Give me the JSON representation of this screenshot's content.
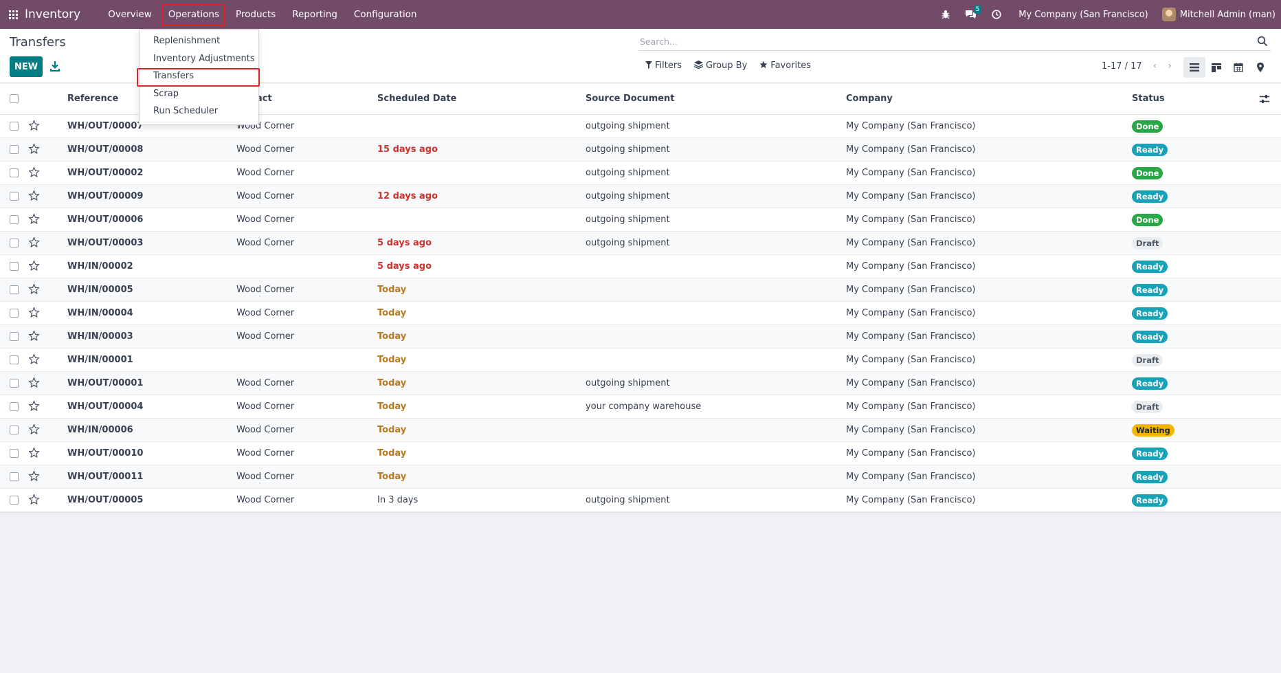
{
  "navbar": {
    "brand": "Inventory",
    "menu": [
      "Overview",
      "Operations",
      "Products",
      "Reporting",
      "Configuration"
    ],
    "messages_count": "5",
    "company": "My Company (San Francisco)",
    "user": "Mitchell Admin (man)"
  },
  "control": {
    "title": "Transfers",
    "new_label": "NEW",
    "search_placeholder": "Search...",
    "filters": "Filters",
    "group_by": "Group By",
    "favorites": "Favorites",
    "pager": "1-17 / 17"
  },
  "dropdown": {
    "items": [
      "Replenishment",
      "Inventory Adjustments",
      "Transfers",
      "Scrap",
      "Run Scheduler"
    ],
    "highlighted": "Transfers"
  },
  "table": {
    "columns": {
      "reference": "Reference",
      "contact": "act",
      "scheduled": "Scheduled Date",
      "source": "Source Document",
      "company": "Company",
      "status": "Status"
    },
    "rows": [
      {
        "ref": "WH/OUT/00007",
        "contact": "Wood Corner",
        "date": "",
        "date_style": "normal",
        "source": "outgoing shipment",
        "company": "My Company (San Francisco)",
        "status": "Done"
      },
      {
        "ref": "WH/OUT/00008",
        "contact": "Wood Corner",
        "date": "15 days ago",
        "date_style": "red",
        "source": "outgoing shipment",
        "company": "My Company (San Francisco)",
        "status": "Ready"
      },
      {
        "ref": "WH/OUT/00002",
        "contact": "Wood Corner",
        "date": "",
        "date_style": "normal",
        "source": "outgoing shipment",
        "company": "My Company (San Francisco)",
        "status": "Done"
      },
      {
        "ref": "WH/OUT/00009",
        "contact": "Wood Corner",
        "date": "12 days ago",
        "date_style": "red",
        "source": "outgoing shipment",
        "company": "My Company (San Francisco)",
        "status": "Ready"
      },
      {
        "ref": "WH/OUT/00006",
        "contact": "Wood Corner",
        "date": "",
        "date_style": "normal",
        "source": "outgoing shipment",
        "company": "My Company (San Francisco)",
        "status": "Done"
      },
      {
        "ref": "WH/OUT/00003",
        "contact": "Wood Corner",
        "date": "5 days ago",
        "date_style": "red",
        "source": "outgoing shipment",
        "company": "My Company (San Francisco)",
        "status": "Draft"
      },
      {
        "ref": "WH/IN/00002",
        "contact": "",
        "date": "5 days ago",
        "date_style": "red",
        "source": "",
        "company": "My Company (San Francisco)",
        "status": "Ready"
      },
      {
        "ref": "WH/IN/00005",
        "contact": "Wood Corner",
        "date": "Today",
        "date_style": "amber",
        "source": "",
        "company": "My Company (San Francisco)",
        "status": "Ready"
      },
      {
        "ref": "WH/IN/00004",
        "contact": "Wood Corner",
        "date": "Today",
        "date_style": "amber",
        "source": "",
        "company": "My Company (San Francisco)",
        "status": "Ready"
      },
      {
        "ref": "WH/IN/00003",
        "contact": "Wood Corner",
        "date": "Today",
        "date_style": "amber",
        "source": "",
        "company": "My Company (San Francisco)",
        "status": "Ready"
      },
      {
        "ref": "WH/IN/00001",
        "contact": "",
        "date": "Today",
        "date_style": "amber",
        "source": "",
        "company": "My Company (San Francisco)",
        "status": "Draft"
      },
      {
        "ref": "WH/OUT/00001",
        "contact": "Wood Corner",
        "date": "Today",
        "date_style": "amber",
        "source": "outgoing shipment",
        "company": "My Company (San Francisco)",
        "status": "Ready"
      },
      {
        "ref": "WH/OUT/00004",
        "contact": "Wood Corner",
        "date": "Today",
        "date_style": "amber",
        "source": "your company warehouse",
        "company": "My Company (San Francisco)",
        "status": "Draft"
      },
      {
        "ref": "WH/IN/00006",
        "contact": "Wood Corner",
        "date": "Today",
        "date_style": "amber",
        "source": "",
        "company": "My Company (San Francisco)",
        "status": "Waiting"
      },
      {
        "ref": "WH/OUT/00010",
        "contact": "Wood Corner",
        "date": "Today",
        "date_style": "amber",
        "source": "",
        "company": "My Company (San Francisco)",
        "status": "Ready"
      },
      {
        "ref": "WH/OUT/00011",
        "contact": "Wood Corner",
        "date": "Today",
        "date_style": "amber",
        "source": "",
        "company": "My Company (San Francisco)",
        "status": "Ready"
      },
      {
        "ref": "WH/OUT/00005",
        "contact": "Wood Corner",
        "date": "In 3 days",
        "date_style": "normal",
        "source": "outgoing shipment",
        "company": "My Company (San Francisco)",
        "status": "Ready"
      }
    ]
  },
  "colors": {
    "navbar": "#714b67",
    "primary": "#017e84",
    "done": "#28a745",
    "ready": "#17a2b8",
    "waiting": "#f5b400",
    "overdue": "#d0312d",
    "today": "#b7791f"
  }
}
